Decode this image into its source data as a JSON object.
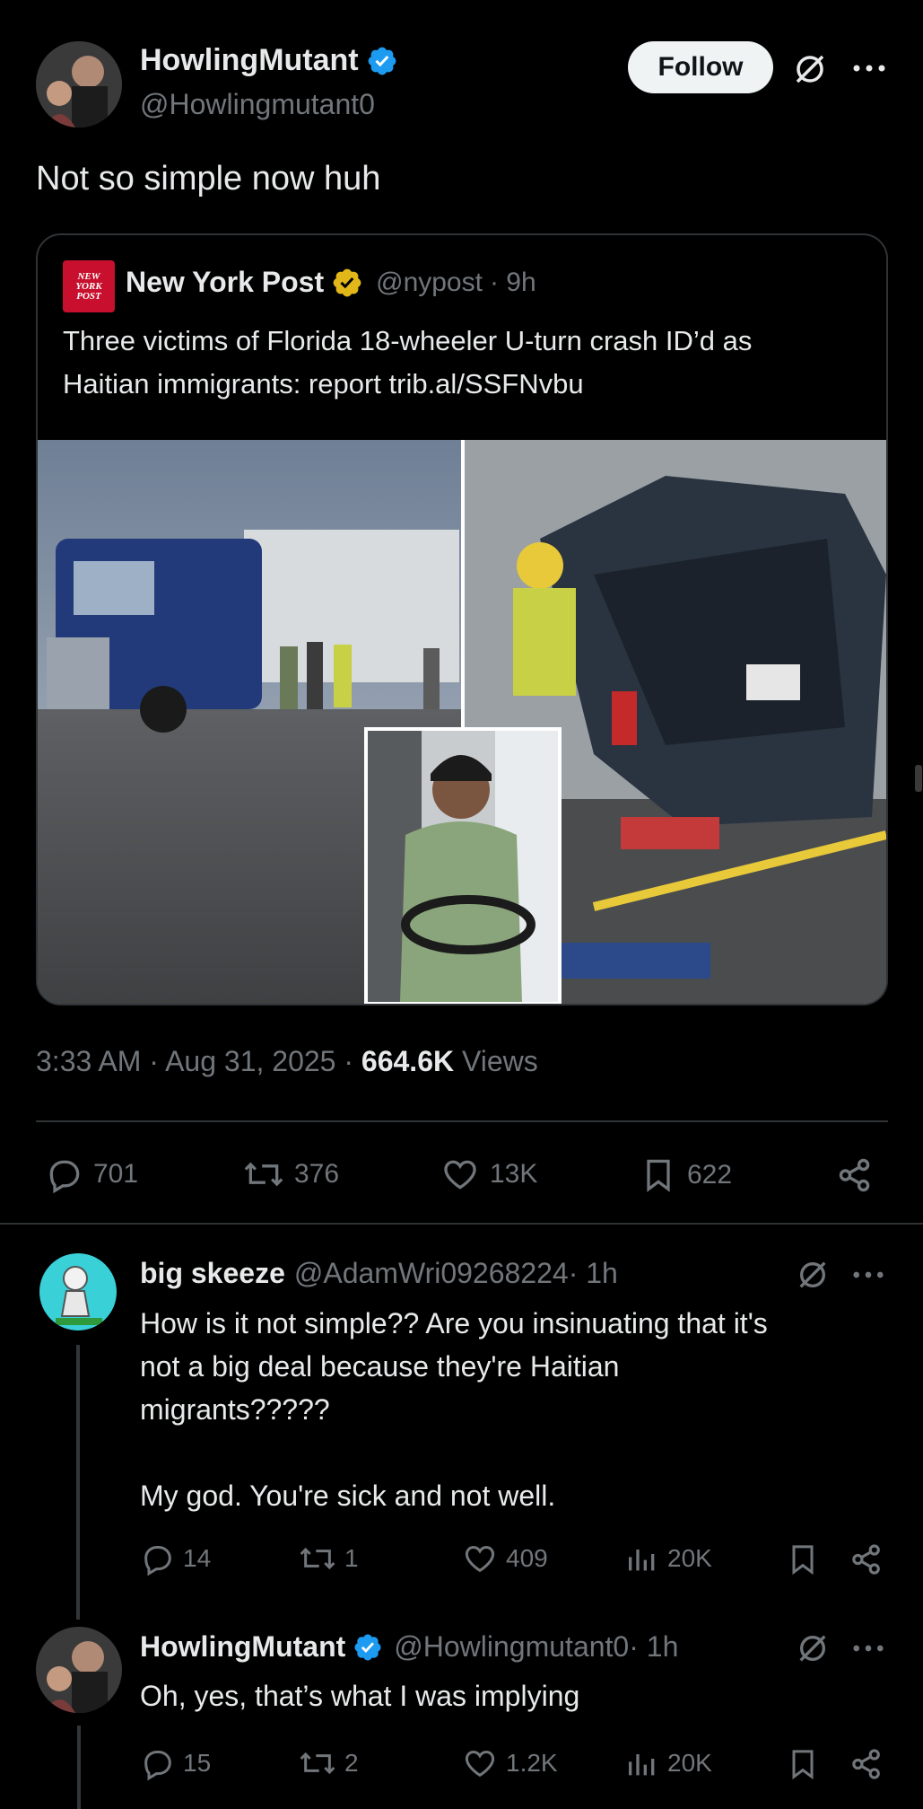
{
  "main_post": {
    "author_name": "HowlingMutant",
    "author_handle": "@Howlingmutant0",
    "follow_label": "Follow",
    "text": "Not so simple now huh",
    "timestamp": "3:33 AM · Aug 31, 2025 · ",
    "views_count": "664.6K",
    "views_label": " Views",
    "stats": {
      "replies": "701",
      "reposts": "376",
      "likes": "13K",
      "bookmarks": "622"
    }
  },
  "quoted_post": {
    "logo_text": "NEW YORK POST",
    "author_name": "New York Post",
    "author_handle": "@nypost",
    "time": " · 9h",
    "text_line1": "Three victims of Florida 18-wheeler U-turn crash ID’d as",
    "text_line2": "Haitian immigrants: report trib.al/SSFNvbu"
  },
  "replies": [
    {
      "author_name": "big skeeze",
      "author_handle": "@AdamWri09268224",
      "time": " · 1h",
      "text_lines": [
        "How is it not simple?? Are you insinuating that it's",
        "not a big deal because they're Haitian",
        "migrants?????",
        "",
        "My god.  You're sick and not well."
      ],
      "stats": {
        "replies": "14",
        "reposts": "1",
        "likes": "409",
        "views": "20K"
      }
    },
    {
      "author_name": "HowlingMutant",
      "author_handle": "@Howlingmutant0",
      "time": " · 1h",
      "text_lines": [
        "Oh, yes, that’s what I was implying"
      ],
      "stats": {
        "replies": "15",
        "reposts": "2",
        "likes": "1.2K",
        "views": "20K"
      }
    }
  ],
  "colors": {
    "background": "#000000",
    "text": "#e7e9ea",
    "muted": "#71767b",
    "verified_blue": "#1d9bf0",
    "verified_gold": "#e2b719",
    "nypost_red": "#c8102e"
  }
}
